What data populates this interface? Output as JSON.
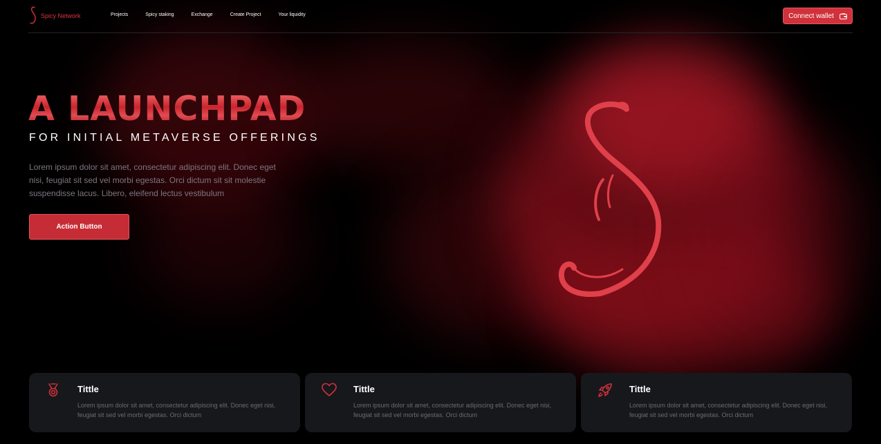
{
  "brand": {
    "name": "Spicy Network",
    "accent": "#d0313a"
  },
  "nav": {
    "links": [
      "Projects",
      "Spicy staking",
      "Exchange",
      "Create Project",
      "Your liquidity"
    ],
    "connect_label": "Connect wallet"
  },
  "hero": {
    "title": "A LAUNCHPAD",
    "subtitle": "FOR INITIAL METAVERSE OFFERINGS",
    "description": "Lorem ipsum dolor sit amet, consectetur adipiscing elit. Donec eget nisi, feugiat sit sed vel morbi egestas. Orci dictum sit sit molestie suspendisse lacus. Libero, eleifend lectus vestibulum",
    "action_label": "Action Button"
  },
  "cards": [
    {
      "icon": "medal-icon",
      "title": "Tittle",
      "text": "Lorem ipsum dolor sit amet, consectetur adipiscing elit. Donec eget nisi, feugiat sit sed vel morbi egestas. Orci dictum"
    },
    {
      "icon": "heart-icon",
      "title": "Tittle",
      "text": "Lorem ipsum dolor sit amet, consectetur adipiscing elit. Donec eget nisi, feugiat sit sed vel morbi egestas. Orci dictum"
    },
    {
      "icon": "rocket-icon",
      "title": "Tittle",
      "text": "Lorem ipsum dolor sit amet, consectetur adipiscing elit. Donec eget nisi, feugiat sit sed vel morbi egestas. Orci dictum"
    }
  ]
}
